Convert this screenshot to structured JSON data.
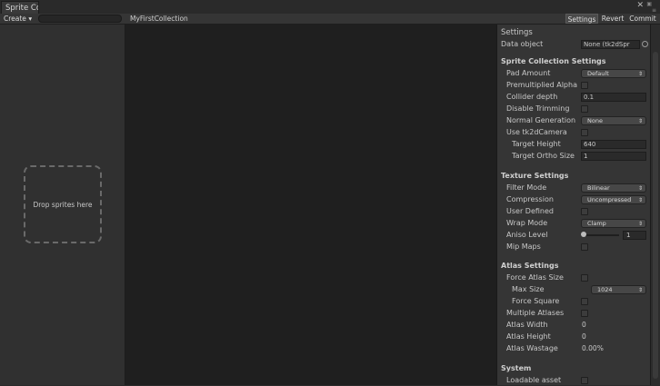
{
  "window": {
    "tab_title": "Sprite Co"
  },
  "toolbar": {
    "create_label": "Create",
    "collection_name": "MyFirstCollection",
    "settings_label": "Settings",
    "revert_label": "Revert",
    "commit_label": "Commit"
  },
  "left": {
    "drop_text": "Drop sprites here"
  },
  "settings": {
    "title": "Settings",
    "data_object_label": "Data object",
    "data_object_value": "None (tk2dSpr",
    "sections": {
      "sprite_collection": "Sprite Collection Settings",
      "texture": "Texture Settings",
      "atlas": "Atlas Settings",
      "system": "System"
    },
    "pad_amount": {
      "label": "Pad Amount",
      "value": "Default"
    },
    "premultiplied_alpha": {
      "label": "Premultiplied Alpha",
      "checked": false
    },
    "collider_depth": {
      "label": "Collider depth",
      "value": "0.1"
    },
    "disable_trimming": {
      "label": "Disable Trimming",
      "checked": false
    },
    "normal_generation": {
      "label": "Normal Generation",
      "value": "None"
    },
    "use_tk2d_camera": {
      "label": "Use tk2dCamera",
      "checked": false
    },
    "target_height": {
      "label": "Target Height",
      "value": "640"
    },
    "target_ortho_size": {
      "label": "Target Ortho Size",
      "value": "1"
    },
    "filter_mode": {
      "label": "Filter Mode",
      "value": "Bilinear"
    },
    "compression": {
      "label": "Compression",
      "value": "Uncompressed"
    },
    "user_defined": {
      "label": "User Defined",
      "checked": false
    },
    "wrap_mode": {
      "label": "Wrap Mode",
      "value": "Clamp"
    },
    "aniso_level": {
      "label": "Aniso Level",
      "value": "1"
    },
    "mip_maps": {
      "label": "Mip Maps",
      "checked": false
    },
    "force_atlas_size": {
      "label": "Force Atlas Size",
      "checked": false
    },
    "max_size": {
      "label": "Max Size",
      "value": "1024"
    },
    "force_square": {
      "label": "Force Square",
      "checked": false
    },
    "multiple_atlases": {
      "label": "Multiple Atlases",
      "checked": false
    },
    "atlas_width": {
      "label": "Atlas Width",
      "value": "0"
    },
    "atlas_height": {
      "label": "Atlas Height",
      "value": "0"
    },
    "atlas_wastage": {
      "label": "Atlas Wastage",
      "value": "0.00%"
    },
    "loadable_asset": {
      "label": "Loadable asset",
      "checked": false
    }
  }
}
